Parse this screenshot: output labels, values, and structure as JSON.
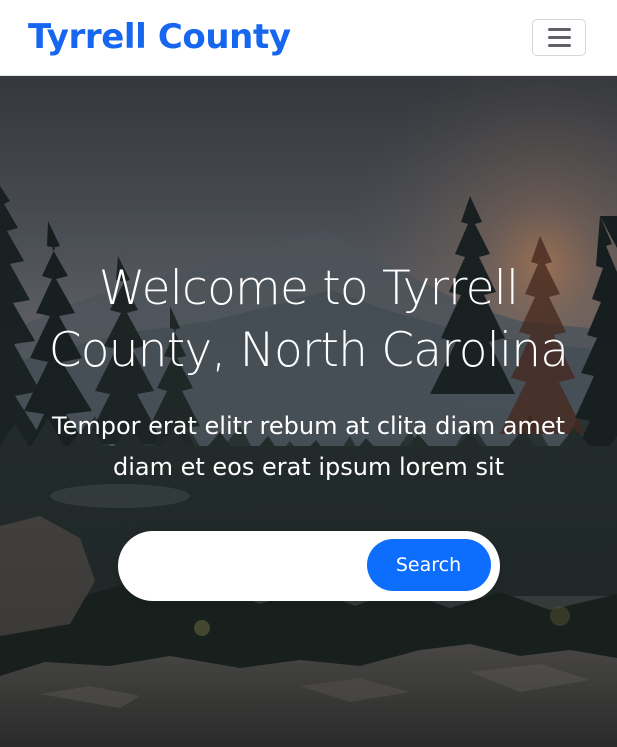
{
  "navbar": {
    "brand": "Tyrrell County",
    "toggle_icon": "menu-icon"
  },
  "hero": {
    "title": "Welcome to Tyrrell County, North Carolina",
    "subtitle": "Tempor erat elitr rebum at clita diam amet diam et eos erat ipsum lorem sit",
    "search": {
      "value": "",
      "placeholder": "",
      "button_label": "Search"
    }
  },
  "colors": {
    "brand": "#1766f0",
    "primary_button": "#0d6efd",
    "overlay": "#000000"
  }
}
